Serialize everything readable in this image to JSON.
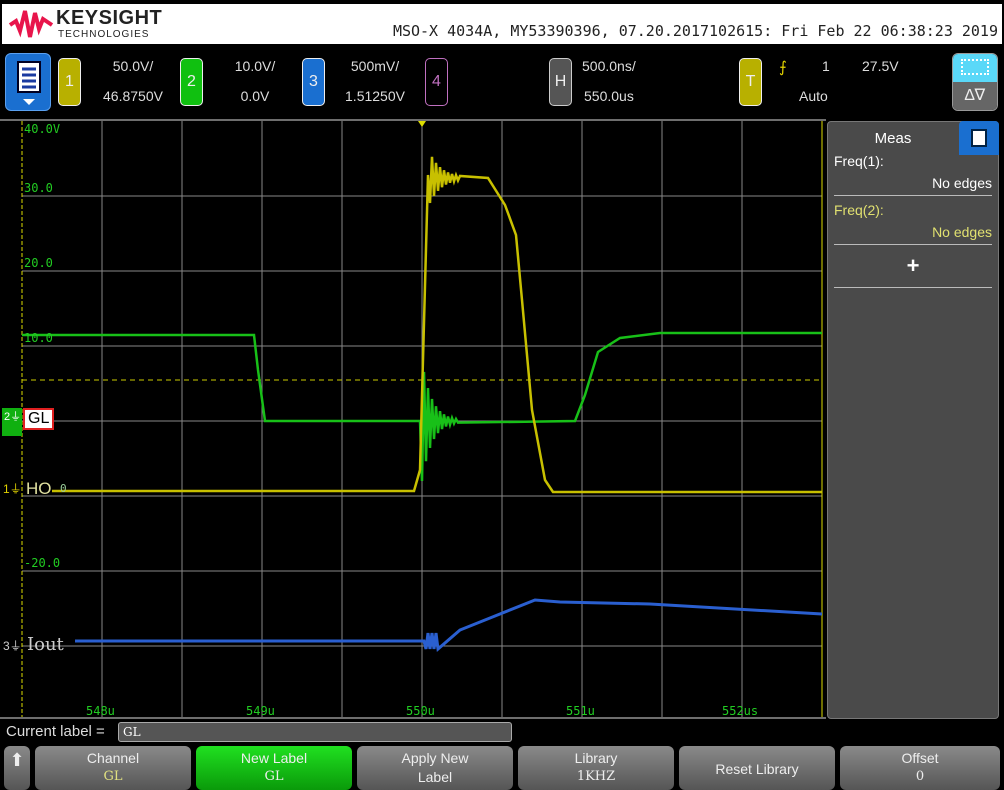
{
  "header": {
    "brand": "KEYSIGHT",
    "brand_sub": "TECHNOLOGIES",
    "model_info": "MSO-X 4034A, MY53390396, 07.20.2017102615: Fri Feb 22 06:38:23 2019"
  },
  "channels": [
    {
      "num": "1",
      "scale": "50.0V/",
      "offset": "46.8750V",
      "color": "#c8c000"
    },
    {
      "num": "2",
      "scale": "10.0V/",
      "offset": "0.0V",
      "color": "#10c010"
    },
    {
      "num": "3",
      "scale": "500mV/",
      "offset": "1.51250V",
      "color": "#1a6fd0"
    },
    {
      "num": "4",
      "color": "#c070c0"
    }
  ],
  "horizontal": {
    "key": "H",
    "scale": "500.0ns/",
    "delay": "550.0us"
  },
  "trigger": {
    "key": "T",
    "source": "1",
    "level": "27.5V",
    "mode": "Auto"
  },
  "grid": {
    "y_labels": [
      "40.0V",
      "30.0",
      "20.0",
      "10.0",
      "-20.0"
    ],
    "x_labels": [
      "548u",
      "549u",
      "550u",
      "551u",
      "552us"
    ]
  },
  "trace_labels": {
    "ch1": "HO",
    "ch2": "GL",
    "ch3": "Iout",
    "ch1_zero": "0"
  },
  "meas": {
    "title": "Meas",
    "items": [
      {
        "label": "Freq(1):",
        "value": "No edges"
      },
      {
        "label": "Freq(2):",
        "value": "No edges"
      }
    ],
    "add": "+"
  },
  "label_bar": {
    "prompt": "Current label =",
    "value": "GL"
  },
  "softkeys": [
    {
      "label": "Channel",
      "value": "GL"
    },
    {
      "label": "New Label",
      "value": "GL"
    },
    {
      "label": "Apply New",
      "value": "Label"
    },
    {
      "label": "Library",
      "value": "1KHZ"
    },
    {
      "label": "Reset Library",
      "value": ""
    },
    {
      "label": "Offset",
      "value": "0"
    }
  ]
}
